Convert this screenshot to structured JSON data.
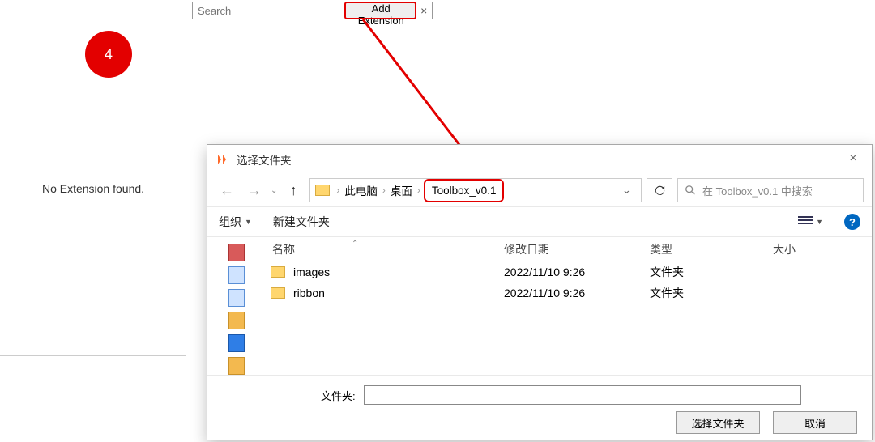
{
  "panel": {
    "empty_text": "No Extension found."
  },
  "searchbar": {
    "placeholder": "Search",
    "add_label": "Add Extension",
    "close_glyph": "×"
  },
  "annotation": {
    "badge_number": "4"
  },
  "dialog": {
    "title": "选择文件夹",
    "nav": {
      "back_glyph": "←",
      "forward_glyph": "→",
      "up_glyph": "↑"
    },
    "breadcrumb": {
      "items": [
        "此电脑",
        "桌面",
        "Toolbox_v0.1"
      ]
    },
    "refresh_glyph": "↻",
    "search_placeholder": "在 Toolbox_v0.1 中搜索",
    "toolbar": {
      "organize": "组织",
      "new_folder": "新建文件夹"
    },
    "columns": {
      "name": "名称",
      "date": "修改日期",
      "type": "类型",
      "size": "大小"
    },
    "rows": [
      {
        "name": "images",
        "date": "2022/11/10 9:26",
        "type": "文件夹",
        "size": ""
      },
      {
        "name": "ribbon",
        "date": "2022/11/10 9:26",
        "type": "文件夹",
        "size": ""
      }
    ],
    "footer": {
      "folder_label": "文件夹:",
      "select_btn": "选择文件夹",
      "cancel_btn": "取消"
    },
    "help_glyph": "?"
  }
}
